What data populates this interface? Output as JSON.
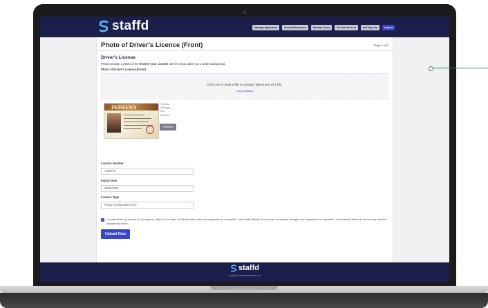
{
  "device": {
    "model_label": "MacBook Pro"
  },
  "header": {
    "brand": "staffd",
    "nav": [
      "Manage Applicants",
      "Survey Responses",
      "Manage Users",
      "Do Not Hire List",
      "Self Sign Up",
      "Logout"
    ]
  },
  "page": {
    "title": "Photo of Driver's Licence (Front)",
    "stage": "Stage 1 of 3"
  },
  "form": {
    "section_title": "Driver's License",
    "instructions_pre": "Please provide a photo of the ",
    "instructions_bold": "front of your License",
    "instructions_post": " with the photo taken on a white background.",
    "photo_label": "Photo of Driver's Licence (Front)",
    "dropzone_text": "Click me or drag a file to upload. Maximum of 1 file.",
    "dropzone_count": "1 file(s) attached.",
    "license_state": "INDIANA",
    "file": {
      "filename_label": "Filename",
      "filename": "Staffd.jpg",
      "size_label": "Size",
      "size": "31.88 kb"
    },
    "remove_label": "Remove",
    "licence_number_label": "Licence Number",
    "licence_number": "7483778",
    "expiry_label": "Expiry Date",
    "expiry": "28/06/2021",
    "type_label": "Licence Type",
    "type_value": "Heavy Combination (HC)",
    "confirm_text": "I confirm that my license is not expired, valid for the class of vehicle listed and not suspended or cancelled. I will notify Affinity if my license conditions change or is suspended or cancelled. I understand failure to do so may result in disciplinary action.",
    "confirm_checked": true,
    "upload_label": "Upload Now"
  },
  "footer": {
    "brand": "staffd",
    "copyright": "Copyright © 2021 Schrable Pty Ltd"
  },
  "colors": {
    "brand_navy": "#1c1f4a",
    "accent_blue": "#3a46c8",
    "callout_green": "#2d8a6a"
  }
}
